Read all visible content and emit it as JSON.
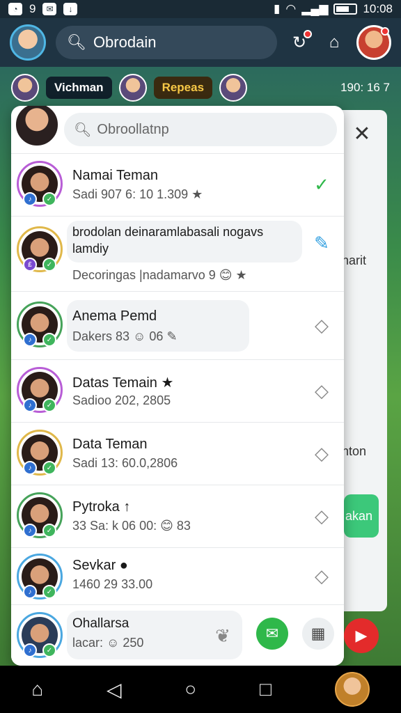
{
  "statusbar": {
    "left_a": "9",
    "time": "10:08",
    "battery_level": "60%"
  },
  "topbar": {
    "search_text": "Obrodain"
  },
  "game_strip": {
    "chip1": "Vichman",
    "chip2": "Repeas",
    "score": "190: 16 7"
  },
  "panel": {
    "search_placeholder": "Obroollatnp",
    "close_label": "✕",
    "rows": [
      {
        "name": "Namai Teman",
        "sub": "Sadi 907 6: 10 1.309 ★",
        "action": "✓"
      },
      {
        "name": "brodolan deinaramlabasali nogavs lamdiy",
        "sub": "Decoringas |nadamarvo 9 😊 ★",
        "action": "✎"
      },
      {
        "name": "Anema Pemd",
        "sub": "Dakers 83 ☺ 06 ✎",
        "action": "◇"
      },
      {
        "name": "Datas Temain ★",
        "sub": "Sadioo 202, 2805",
        "action": "◇"
      },
      {
        "name": "Data Teman",
        "sub": "Sadi 13: 60.0,2806",
        "action": "◇"
      },
      {
        "name": "Pytroka ↑",
        "sub": "33 Sa: k 06 00: 😊 83",
        "action": "◇"
      },
      {
        "name": "Sevkar ●",
        "sub": "1460 29 33.00",
        "action": "◇"
      }
    ],
    "composer": {
      "name": "Ohallarsa",
      "sub": "lacar: ☺ 250"
    }
  },
  "backpanel": {
    "text1": "narit",
    "text2": "anton",
    "green_text": "akan"
  },
  "nav": {
    "home": "⌂",
    "back": "◁",
    "circle": "○",
    "square": "□"
  }
}
